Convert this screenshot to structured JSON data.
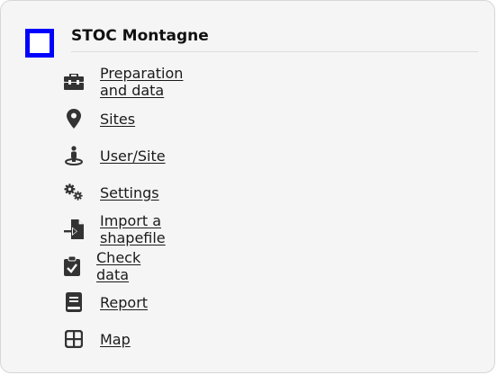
{
  "app": {
    "title": "STOC Montagne",
    "accent_color": "#0000ff"
  },
  "menu": [
    {
      "label": "Preparation and data",
      "icon": "toolbox-icon"
    },
    {
      "label": "Sites",
      "icon": "map-marker-icon"
    },
    {
      "label": "User/Site",
      "icon": "user-location-icon"
    },
    {
      "label": "Settings",
      "icon": "gears-icon"
    },
    {
      "label": "Import a shapefile",
      "icon": "file-import-icon"
    },
    {
      "label": "Check data",
      "icon": "clipboard-check-icon"
    },
    {
      "label": "Report",
      "icon": "book-icon"
    },
    {
      "label": "Map",
      "icon": "grid-map-icon"
    }
  ]
}
